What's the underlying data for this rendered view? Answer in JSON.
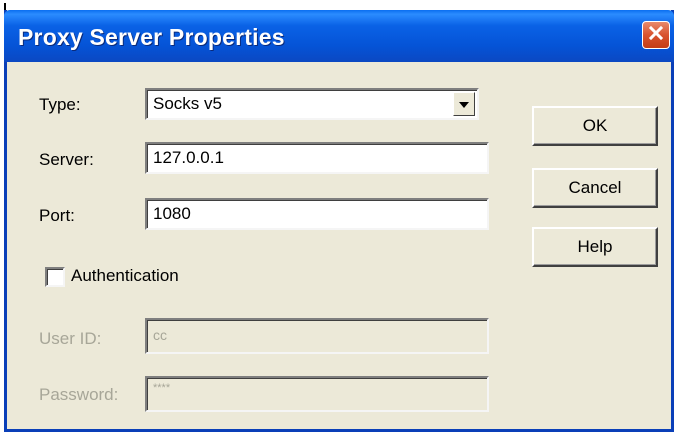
{
  "window": {
    "title": "Proxy Server Properties",
    "close_icon": "close-icon"
  },
  "form": {
    "type_label": "Type:",
    "type_value": "Socks v5",
    "server_label": "Server:",
    "server_value": "127.0.0.1",
    "port_label": "Port:",
    "port_value": "1080",
    "auth_label": "Authentication",
    "auth_checked": false,
    "userid_label": "User ID:",
    "userid_value": "cc",
    "password_label": "Password:",
    "password_value": "****"
  },
  "buttons": {
    "ok": "OK",
    "cancel": "Cancel",
    "help": "Help"
  },
  "colors": {
    "titlebar": "#0553d6",
    "close_button": "#d8532f",
    "dialog_bg": "#ece9d8",
    "disabled_text": "#a7a698"
  }
}
